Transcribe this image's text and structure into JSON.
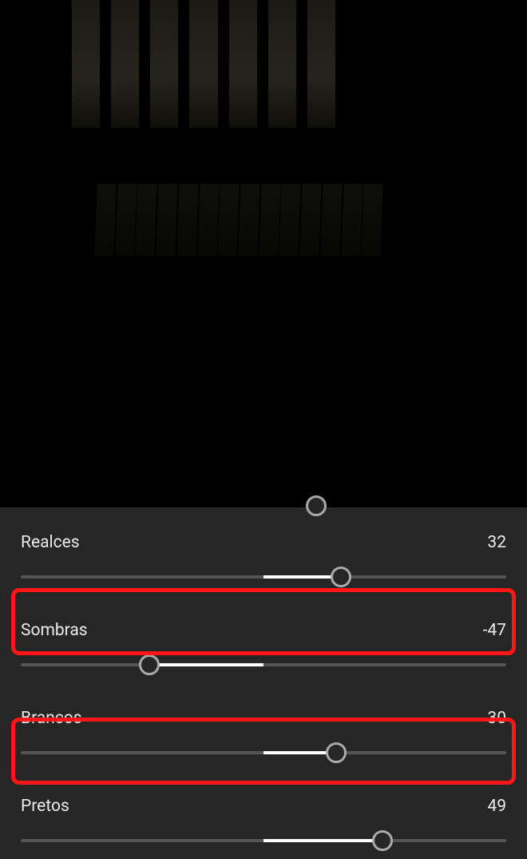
{
  "sliders": {
    "realces": {
      "label": "Realces",
      "value": 32,
      "min": -100,
      "max": 100
    },
    "sombras": {
      "label": "Sombras",
      "value": -47,
      "min": -100,
      "max": 100
    },
    "brancos": {
      "label": "Brancos",
      "value": 30,
      "min": -100,
      "max": 100
    },
    "pretos": {
      "label": "Pretos",
      "value": 49,
      "min": -100,
      "max": 100
    }
  }
}
